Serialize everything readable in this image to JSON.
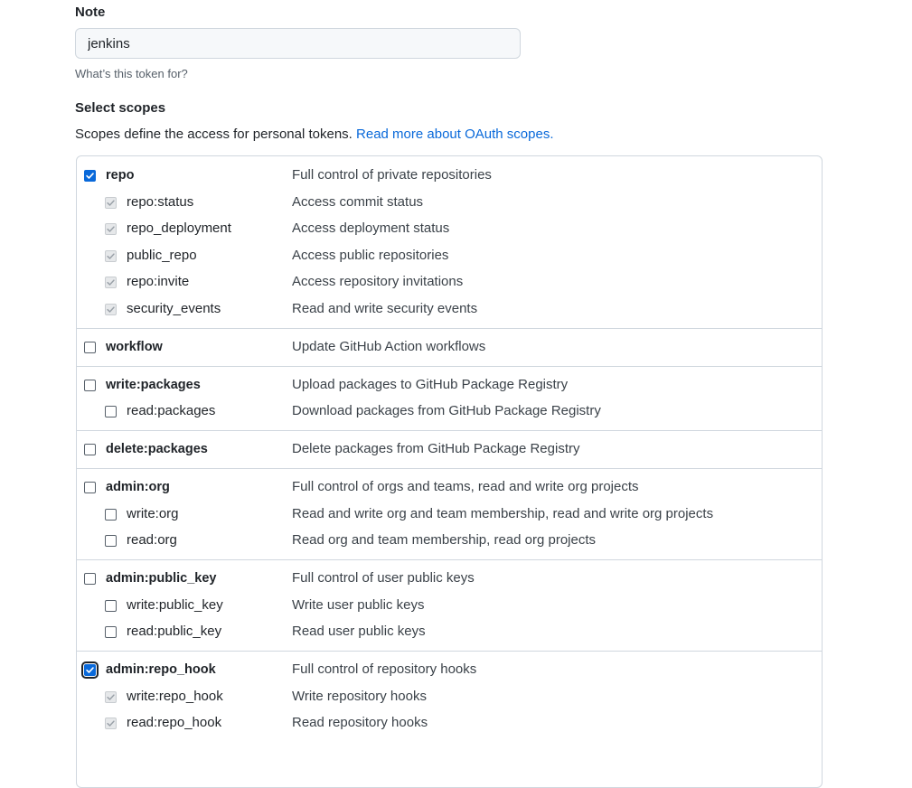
{
  "note": {
    "label": "Note",
    "value": "jenkins",
    "hint": "What’s this token for?"
  },
  "scopes": {
    "heading": "Select scopes",
    "description": "Scopes define the access for personal tokens.",
    "link_text": "Read more about OAuth scopes.",
    "groups": [
      {
        "name": "repo",
        "description": "Full control of private repositories",
        "state": "checked",
        "children": [
          {
            "name": "repo:status",
            "description": "Access commit status",
            "state": "disabled-checked"
          },
          {
            "name": "repo_deployment",
            "description": "Access deployment status",
            "state": "disabled-checked"
          },
          {
            "name": "public_repo",
            "description": "Access public repositories",
            "state": "disabled-checked"
          },
          {
            "name": "repo:invite",
            "description": "Access repository invitations",
            "state": "disabled-checked"
          },
          {
            "name": "security_events",
            "description": "Read and write security events",
            "state": "disabled-checked"
          }
        ]
      },
      {
        "name": "workflow",
        "description": "Update GitHub Action workflows",
        "state": "unchecked",
        "children": []
      },
      {
        "name": "write:packages",
        "description": "Upload packages to GitHub Package Registry",
        "state": "unchecked",
        "children": [
          {
            "name": "read:packages",
            "description": "Download packages from GitHub Package Registry",
            "state": "unchecked"
          }
        ]
      },
      {
        "name": "delete:packages",
        "description": "Delete packages from GitHub Package Registry",
        "state": "unchecked",
        "children": []
      },
      {
        "name": "admin:org",
        "description": "Full control of orgs and teams, read and write org projects",
        "state": "unchecked",
        "children": [
          {
            "name": "write:org",
            "description": "Read and write org and team membership, read and write org projects",
            "state": "unchecked"
          },
          {
            "name": "read:org",
            "description": "Read org and team membership, read org projects",
            "state": "unchecked"
          }
        ]
      },
      {
        "name": "admin:public_key",
        "description": "Full control of user public keys",
        "state": "unchecked",
        "children": [
          {
            "name": "write:public_key",
            "description": "Write user public keys",
            "state": "unchecked"
          },
          {
            "name": "read:public_key",
            "description": "Read user public keys",
            "state": "unchecked"
          }
        ]
      },
      {
        "name": "admin:repo_hook",
        "description": "Full control of repository hooks",
        "state": "checked-focused",
        "children": [
          {
            "name": "write:repo_hook",
            "description": "Write repository hooks",
            "state": "disabled-checked"
          },
          {
            "name": "read:repo_hook",
            "description": "Read repository hooks",
            "state": "disabled-checked"
          }
        ]
      }
    ]
  }
}
